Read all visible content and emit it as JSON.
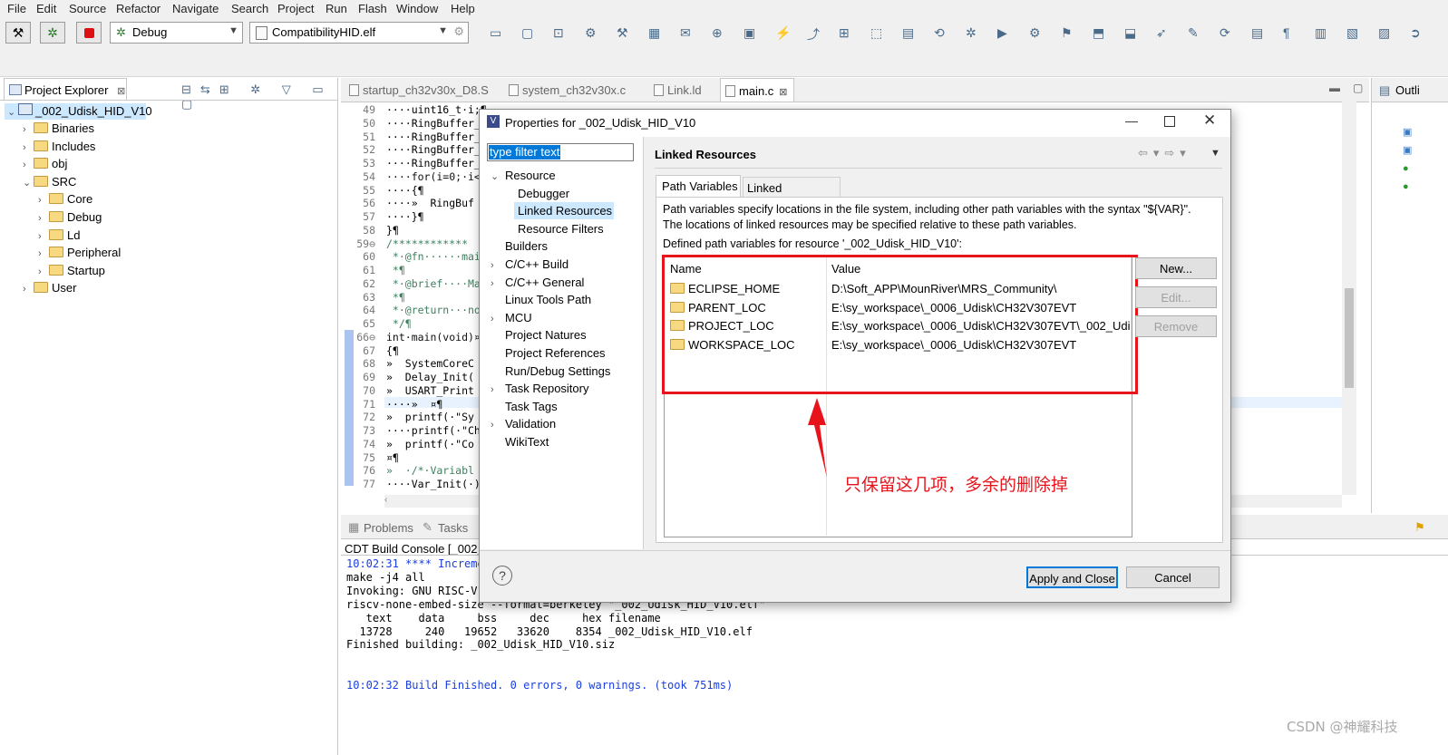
{
  "menu": [
    "File",
    "Edit",
    "Source",
    "Refactor",
    "Navigate",
    "Search",
    "Project",
    "Run",
    "Flash",
    "Window",
    "Help"
  ],
  "toolbar": {
    "build_config": "Debug",
    "launch_target": "CompatibilityHID.elf"
  },
  "project_explorer": {
    "title": "Project Explorer",
    "tab_suffix": "⊠",
    "root": "_002_Udisk_HID_V10",
    "items": [
      {
        "label": "Binaries",
        "indent": 1,
        "expanded": false
      },
      {
        "label": "Includes",
        "indent": 1,
        "expanded": false
      },
      {
        "label": "obj",
        "indent": 1,
        "expanded": false
      },
      {
        "label": "SRC",
        "indent": 1,
        "expanded": true
      },
      {
        "label": "Core",
        "indent": 2,
        "expanded": false
      },
      {
        "label": "Debug",
        "indent": 2,
        "expanded": false
      },
      {
        "label": "Ld",
        "indent": 2,
        "expanded": false
      },
      {
        "label": "Peripheral",
        "indent": 2,
        "expanded": false
      },
      {
        "label": "Startup",
        "indent": 2,
        "expanded": false
      },
      {
        "label": "User",
        "indent": 1,
        "expanded": false
      }
    ]
  },
  "editor": {
    "tabs": [
      "startup_ch32v30x_D8.S",
      "system_ch32v30x.c",
      "Link.ld",
      "main.c"
    ],
    "active_tab": "main.c",
    "line_numbers": [
      "49",
      "50",
      "51",
      "52",
      "53",
      "54",
      "55",
      "56",
      "57",
      "58",
      "59⊖",
      "60",
      "61",
      "62",
      "63",
      "64",
      "65",
      "66⊖",
      "67",
      "68",
      "69",
      "70",
      "71",
      "72",
      "73",
      "74",
      "75",
      "76",
      "77"
    ],
    "lines": [
      "····uint16_t·i;¶",
      "····RingBuffer_",
      "····RingBuffer_",
      "····RingBuffer_",
      "····RingBuffer_",
      "····for(i=0;·i<",
      "····{¶",
      "····»  RingBuf",
      "····}¶",
      "}¶",
      "/************",
      " *·@fn······mai",
      " *¶",
      " *·@brief····Mai",
      " *¶",
      " *·@return···non",
      " */¶",
      "int·main(void)¤",
      "{¶",
      "»  SystemCoreC",
      "»  Delay_Init(",
      "»  USART_Print",
      "····»  ¤¶",
      "»  printf(·\"Sy",
      "····printf(·\"Ch",
      "»  printf(·\"Co",
      "¤¶",
      "»  ·/*·Variabl",
      "····Var_Init(·)"
    ]
  },
  "outline": {
    "title": "Outli"
  },
  "bottom_panel": {
    "tabs": [
      "Problems",
      "Tasks"
    ],
    "console_title": "CDT Build Console [_002_",
    "lines": [
      {
        "text": "10:02:31 **** Increme",
        "color": "#1a3ee0"
      },
      {
        "text": "make -j4 all",
        "color": "#000"
      },
      {
        "text": "Invoking: GNU RISC-V C",
        "color": "#000"
      },
      {
        "text": "riscv-none-embed-size --format=berkeley \"_002_Udisk_HID_V10.elf\"",
        "color": "#000"
      },
      {
        "text": "   text    data     bss     dec     hex filename",
        "color": "#000"
      },
      {
        "text": "  13728     240   19652   33620    8354 _002_Udisk_HID_V10.elf",
        "color": "#000"
      },
      {
        "text": "Finished building: _002_Udisk_HID_V10.siz",
        "color": "#000"
      },
      {
        "text": "",
        "color": "#000"
      },
      {
        "text": "",
        "color": "#000"
      },
      {
        "text": "10:02:32 Build Finished. 0 errors, 0 warnings. (took 751ms)",
        "color": "#1a3ee0"
      }
    ]
  },
  "dialog": {
    "title": "Properties for _002_Udisk_HID_V10",
    "filter_placeholder": "type filter text",
    "nav": [
      {
        "label": "Resource",
        "level": 0,
        "arrow": "expanded"
      },
      {
        "label": "Debugger",
        "level": 1,
        "arrow": "none"
      },
      {
        "label": "Linked Resources",
        "level": 1,
        "arrow": "none",
        "selected": true
      },
      {
        "label": "Resource Filters",
        "level": 1,
        "arrow": "none"
      },
      {
        "label": "Builders",
        "level": 0,
        "arrow": "none"
      },
      {
        "label": "C/C++ Build",
        "level": 0,
        "arrow": "collapsed"
      },
      {
        "label": "C/C++ General",
        "level": 0,
        "arrow": "collapsed"
      },
      {
        "label": "Linux Tools Path",
        "level": 0,
        "arrow": "none"
      },
      {
        "label": "MCU",
        "level": 0,
        "arrow": "collapsed"
      },
      {
        "label": "Project Natures",
        "level": 0,
        "arrow": "none"
      },
      {
        "label": "Project References",
        "level": 0,
        "arrow": "none"
      },
      {
        "label": "Run/Debug Settings",
        "level": 0,
        "arrow": "none"
      },
      {
        "label": "Task Repository",
        "level": 0,
        "arrow": "collapsed"
      },
      {
        "label": "Task Tags",
        "level": 0,
        "arrow": "none"
      },
      {
        "label": "Validation",
        "level": 0,
        "arrow": "collapsed"
      },
      {
        "label": "WikiText",
        "level": 0,
        "arrow": "none"
      }
    ],
    "page_title": "Linked Resources",
    "tabs": [
      "Path Variables",
      "Linked Resources"
    ],
    "active_tab": "Path Variables",
    "description_1": "Path variables specify locations in the file system, including other path variables with the syntax \"${VAR}\".",
    "description_2": "The locations of linked resources may be specified relative to these path variables.",
    "defined_label": "Defined path variables for resource '_002_Udisk_HID_V10':",
    "table": {
      "col_name": "Name",
      "col_value": "Value",
      "rows": [
        {
          "name": "ECLIPSE_HOME",
          "value": "D:\\Soft_APP\\MounRiver\\MRS_Community\\"
        },
        {
          "name": "PARENT_LOC",
          "value": "E:\\sy_workspace\\_0006_Udisk\\CH32V307EVT"
        },
        {
          "name": "PROJECT_LOC",
          "value": "E:\\sy_workspace\\_0006_Udisk\\CH32V307EVT\\_002_Udi..."
        },
        {
          "name": "WORKSPACE_LOC",
          "value": "E:\\sy_workspace\\_0006_Udisk\\CH32V307EVT"
        }
      ]
    },
    "buttons": {
      "new": "New...",
      "edit": "Edit...",
      "remove": "Remove",
      "apply_close": "Apply and Close",
      "cancel": "Cancel"
    },
    "help_glyph": "?",
    "annotation": "只保留这几项，多余的删除掉"
  },
  "watermark": "CSDN @神耀科技",
  "colors": {
    "annotation_red": "#e8141c",
    "selection_blue": "#cce8ff",
    "link_blue": "#1a3ee0"
  }
}
